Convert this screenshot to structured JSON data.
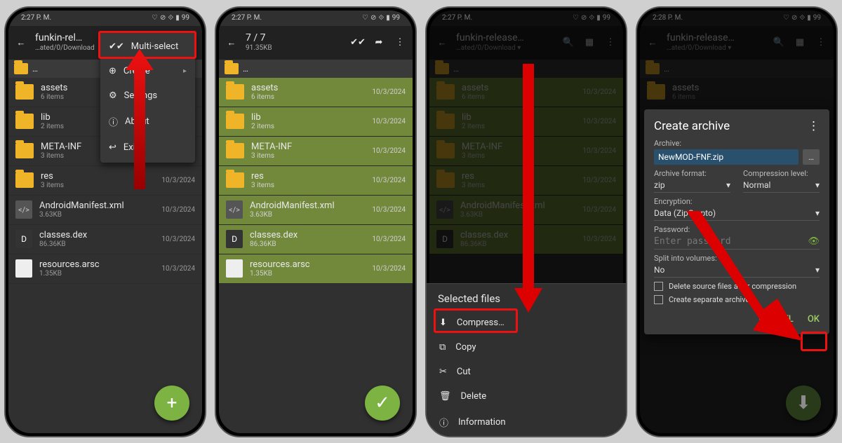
{
  "status": {
    "time_a": "2:27 P. M.",
    "time_b": "2:28 P. M.",
    "battery": "99"
  },
  "app": {
    "title": "funkin-rel…",
    "title_long": "funkin-release…",
    "path": "…ated/0/Download",
    "select_count": "7 / 7",
    "select_size": "91.35KB"
  },
  "crumb": "…",
  "files": [
    {
      "name": "assets",
      "sub": "6 items",
      "date": "10/3/2024",
      "type": "folder"
    },
    {
      "name": "lib",
      "sub": "2 items",
      "date": "10/3/2024",
      "type": "folder"
    },
    {
      "name": "META-INF",
      "sub": "3 items",
      "date": "10/3/2024",
      "type": "folder"
    },
    {
      "name": "res",
      "sub": "3 items",
      "date": "10/3/2024",
      "type": "folder"
    },
    {
      "name": "AndroidManifest.xml",
      "sub": "3.63KB",
      "date": "10/3/2024",
      "type": "xml"
    },
    {
      "name": "classes.dex",
      "sub": "86.36KB",
      "date": "10/3/2024",
      "type": "dex"
    },
    {
      "name": "resources.arsc",
      "sub": "1.35KB",
      "date": "10/3/2024",
      "type": "file"
    }
  ],
  "menu": {
    "multi": "Multi-select",
    "create": "Create",
    "settings": "Settings",
    "about": "About",
    "exit": "Exit"
  },
  "sheet": {
    "title": "Selected files",
    "compress": "Compress…",
    "copy": "Copy",
    "cut": "Cut",
    "delete": "Delete",
    "info": "Information"
  },
  "dialog": {
    "title": "Create archive",
    "archive_lbl": "Archive:",
    "archive_val": "NewMOD-FNF.zip",
    "browse": "…",
    "format_lbl": "Archive format:",
    "format_val": "zip",
    "level_lbl": "Compression level:",
    "level_val": "Normal",
    "enc_lbl": "Encryption:",
    "enc_val": "Data (ZipCrypto)",
    "pw_lbl": "Password:",
    "pw_ph": "Enter password",
    "split_lbl": "Split into volumes:",
    "split_val": "No",
    "cb1": "Delete source files after compression",
    "cb2": "Create separate archive",
    "cancel": "CANCEL",
    "ok": "OK"
  }
}
